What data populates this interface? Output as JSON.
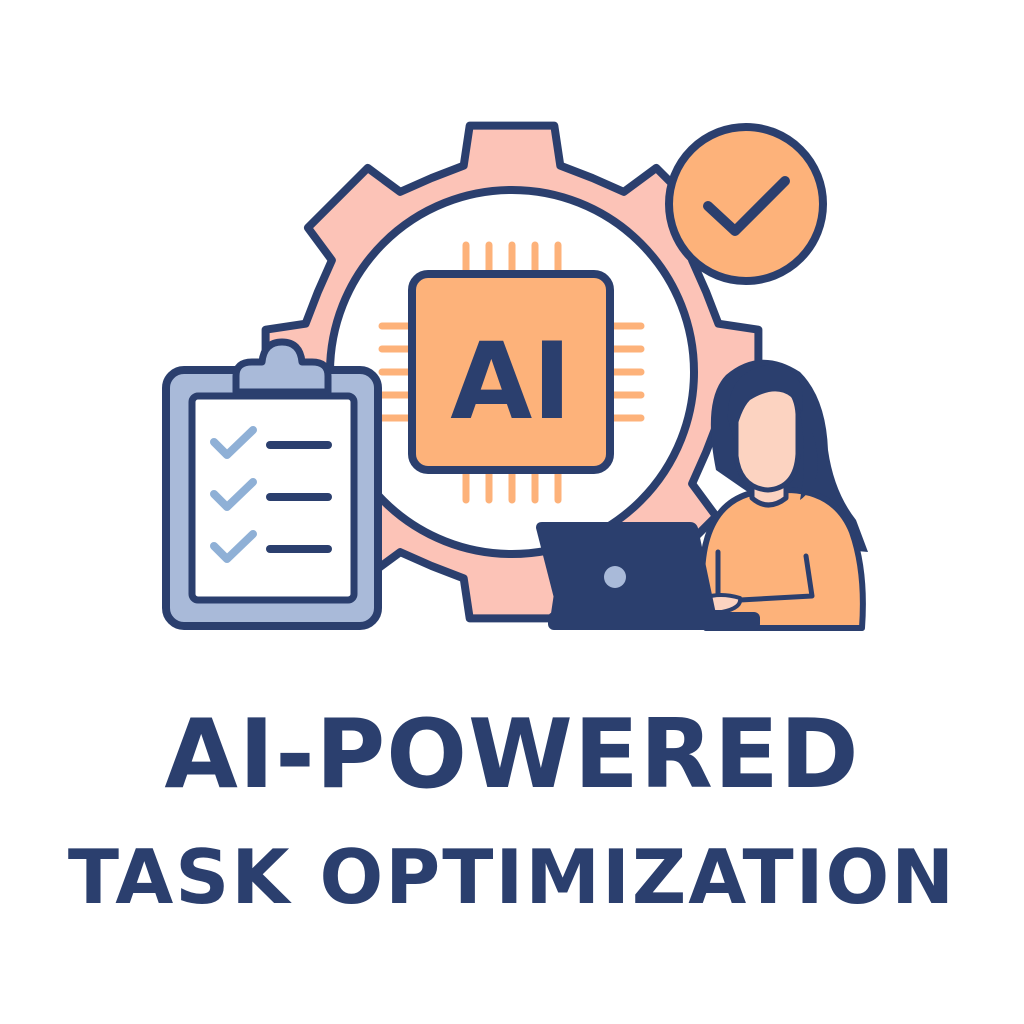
{
  "chip": {
    "label": "AI"
  },
  "title": {
    "line1": "AI-POWERED",
    "line2": "TASK OPTIMIZATION"
  },
  "icons": {
    "gear": "gear-icon",
    "chip": "ai-chip-icon",
    "check_badge": "check-badge-icon",
    "clipboard": "clipboard-checklist-icon",
    "person": "person-icon",
    "laptop": "laptop-icon"
  },
  "colors": {
    "navy": "#2b3f6e",
    "gear_pink": "#fcc3b7",
    "orange": "#fdb27a",
    "skin": "#fcd3c1",
    "clipboard_blue": "#a9bad9",
    "check_blue": "#8fb0d6"
  }
}
